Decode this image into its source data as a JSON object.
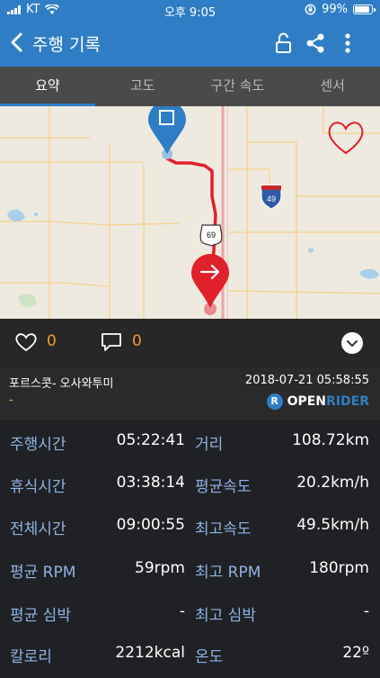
{
  "status_bar": {
    "carrier": "KT",
    "time": "오후 9:05",
    "battery": "99%"
  },
  "header": {
    "title": "주행 기록"
  },
  "tabs": [
    {
      "label": "요약",
      "active": true
    },
    {
      "label": "고도",
      "active": false
    },
    {
      "label": "구간 속도",
      "active": false
    },
    {
      "label": "센서",
      "active": false
    }
  ],
  "map": {
    "highway_shields": [
      "49",
      "69"
    ]
  },
  "social": {
    "likes": "0",
    "comments": "0"
  },
  "ride": {
    "name": "포르스콧- 오사와투미",
    "datetime": "2018-07-21 05:58:55",
    "subtitle": "-",
    "brand_open": "OPEN",
    "brand_rider": "RIDER"
  },
  "stats": [
    {
      "label1": "주행시간",
      "value1": "05:22:41",
      "label2": "거리",
      "value2": "108.72km"
    },
    {
      "label1": "휴식시간",
      "value1": "03:38:14",
      "label2": "평균속도",
      "value2": "20.2km/h"
    },
    {
      "label1": "전체시간",
      "value1": "09:00:55",
      "label2": "최고속도",
      "value2": "49.5km/h"
    },
    {
      "label1": "평균 RPM",
      "value1": "59rpm",
      "label2": "최고 RPM",
      "value2": "180rpm"
    },
    {
      "label1": "평균 심박",
      "value1": "-",
      "label2": "최고 심박",
      "value2": "-"
    },
    {
      "label1": "칼로리",
      "value1": "2212kcal",
      "label2": "온도",
      "value2": "22º"
    }
  ],
  "colors": {
    "accent": "#2f7ec5",
    "label": "#8fb4e4",
    "count": "#f39a2b",
    "route": "#e0202a"
  }
}
